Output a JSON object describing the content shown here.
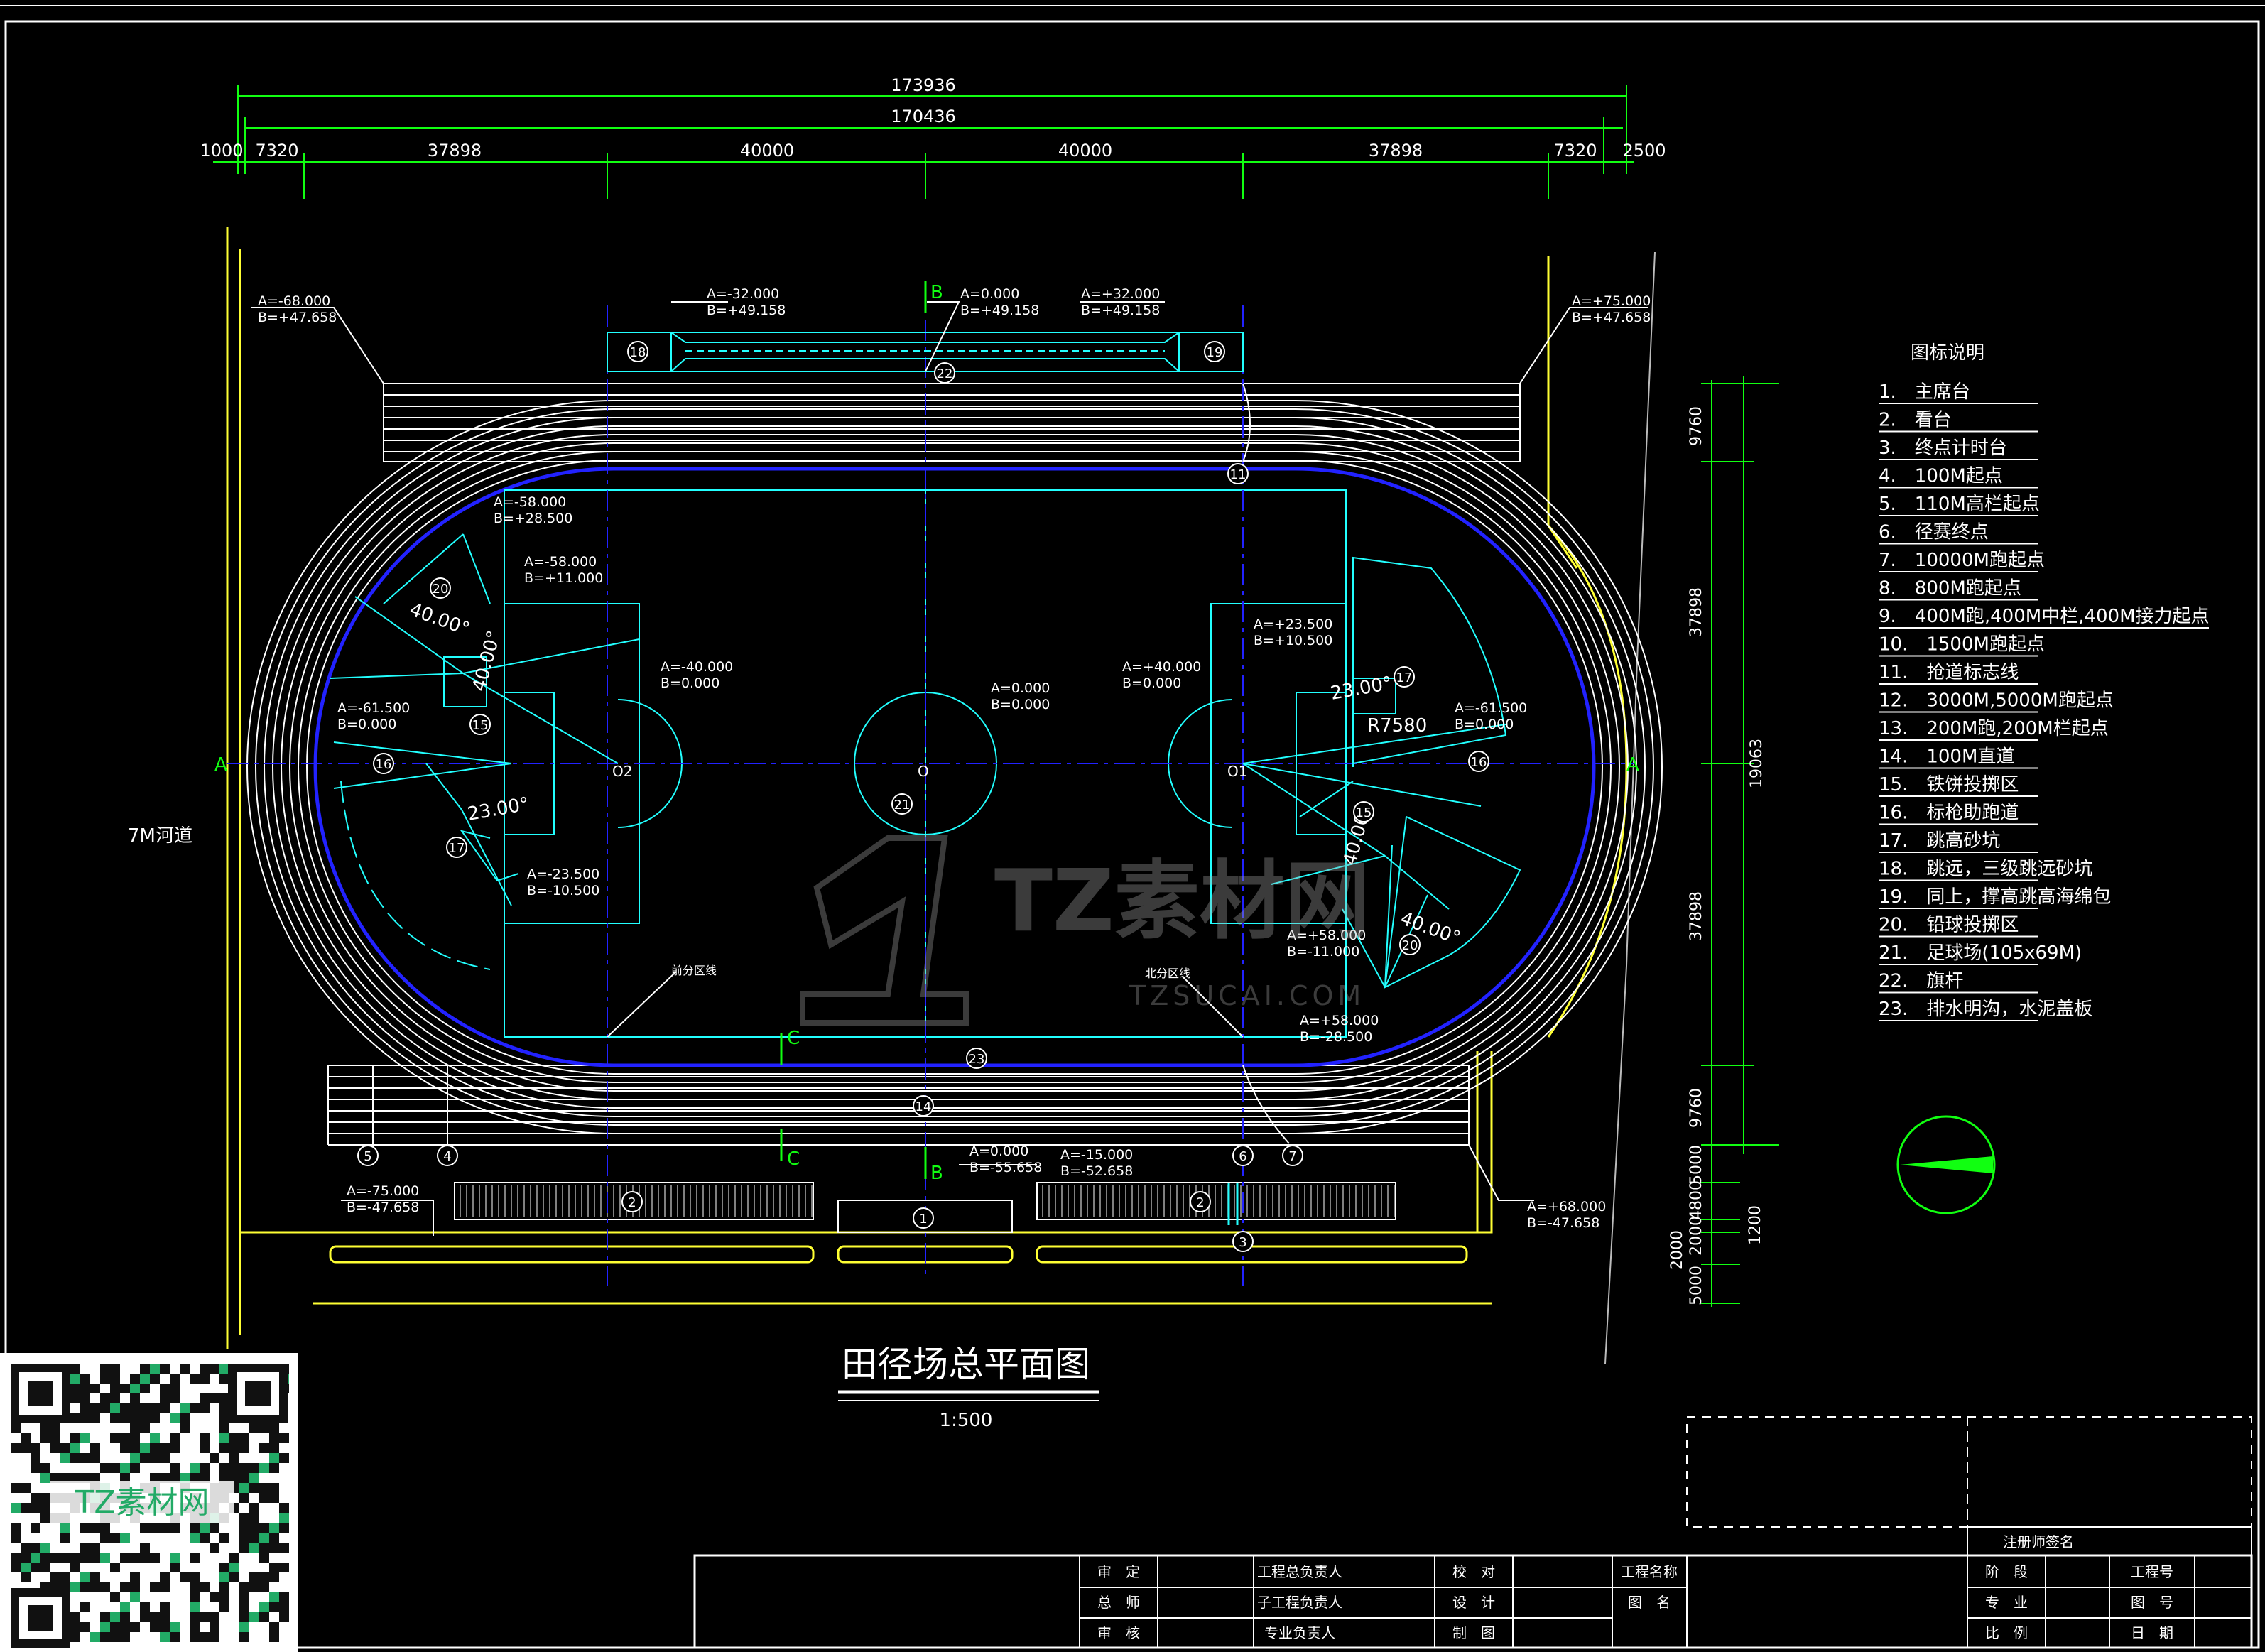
{
  "title": "田径场总平面图",
  "scale": "1:500",
  "dimensions": {
    "total_outer": "173936",
    "total_inner": "170436",
    "segments": [
      "1000",
      "7320",
      "37898",
      "40000",
      "40000",
      "37898",
      "7320",
      "2500"
    ],
    "vertical_right": [
      "9760",
      "37898",
      "37898",
      "9760"
    ],
    "vertical_total": "19063",
    "vertical_bottom": [
      "5000",
      "4800",
      "2000",
      "2000",
      "5000",
      "1200"
    ]
  },
  "river_label": "7M河道",
  "axis_labels": {
    "a": "A",
    "b": "B",
    "c": "C"
  },
  "coords": [
    {
      "a": "A=-68.000",
      "b": "B=+47.658"
    },
    {
      "a": "A=-32.000",
      "b": "B=+49.158"
    },
    {
      "a": "A=0.000",
      "b": "B=+49.158"
    },
    {
      "a": "A=+32.000",
      "b": "B=+49.158"
    },
    {
      "a": "A=+75.000",
      "b": "B=+47.658"
    },
    {
      "a": "A=-58.000",
      "b": "B=+28.500"
    },
    {
      "a": "A=-58.000",
      "b": "B=+11.000"
    },
    {
      "a": "A=-40.000",
      "b": "B=0.000"
    },
    {
      "a": "A=-61.500",
      "b": "B=0.000"
    },
    {
      "a": "A=-23.500",
      "b": "B=-10.500"
    },
    {
      "a": "A=0.000",
      "b": "B=0.000"
    },
    {
      "a": "A=+23.500",
      "b": "B=+10.500"
    },
    {
      "a": "A=+40.000",
      "b": "B=0.000"
    },
    {
      "a": "A=-61.500",
      "b": "B=0.000"
    },
    {
      "a": "A=+58.000",
      "b": "B=-11.000"
    },
    {
      "a": "A=+58.000",
      "b": "B=-28.500"
    },
    {
      "a": "A=-75.000",
      "b": "B=-47.658"
    },
    {
      "a": "A=0.000",
      "b": "B=-55.658"
    },
    {
      "a": "A=-15.000",
      "b": "B=-52.658"
    },
    {
      "a": "A=+68.000",
      "b": "B=-47.658"
    }
  ],
  "angles": [
    "40.00°",
    "40.00°",
    "23.00°",
    "23.00°",
    "40.00°",
    "40.00°"
  ],
  "radius": "R7580",
  "centers": [
    "O2",
    "O",
    "O1"
  ],
  "zone_lines": [
    "前分区线",
    "北分区线"
  ],
  "legend": {
    "title": "图标说明",
    "items": [
      "1.　主席台",
      "2.　看台",
      "3.　终点计时台",
      "4.　100M起点",
      "5.　110M高栏起点",
      "6.　径赛终点",
      "7.　10000M跑起点",
      "8.　800M跑起点",
      "9.　400M跑,400M中栏,400M接力起点",
      "10.　1500M跑起点",
      "11.　抢道标志线",
      "12.　3000M,5000M跑起点",
      "13.　200M跑,200M栏起点",
      "14.　100M直道",
      "15.　铁饼投掷区",
      "16.　标枪助跑道",
      "17.　跳高砂坑",
      "18.　跳远，三级跳远砂坑",
      "19.　同上，撑高跳高海绵包",
      "20.　铅球投掷区",
      "21.　足球场(105x69M)",
      "22.　旗杆",
      "23.　排水明沟，水泥盖板"
    ]
  },
  "markers": [
    "1",
    "2",
    "2",
    "3",
    "4",
    "5",
    "6",
    "7",
    "11",
    "14",
    "15",
    "15",
    "16",
    "16",
    "17",
    "17",
    "18",
    "19",
    "20",
    "20",
    "21",
    "22",
    "23"
  ],
  "watermark": {
    "text": "TZ素材网",
    "sub": "TZSUCAI.COM",
    "qr_label": "TZ素材网"
  },
  "title_block": {
    "signature_header": "注册师签名",
    "rows": [
      [
        "审　定",
        "工程总负责人",
        "校　对",
        "工程名称",
        "阶　段",
        "工程号"
      ],
      [
        "总　师",
        "子工程负责人",
        "设　计",
        "图　名",
        "专　业",
        "图　号"
      ],
      [
        "审　核",
        "专业负责人",
        "制　图",
        "",
        "比　例",
        "日　期"
      ]
    ]
  },
  "colors": {
    "line": "#ffffff",
    "cyan": "#22ffff",
    "blue": "#2222ff",
    "green": "#11ff11",
    "yellow": "#ffff33"
  }
}
